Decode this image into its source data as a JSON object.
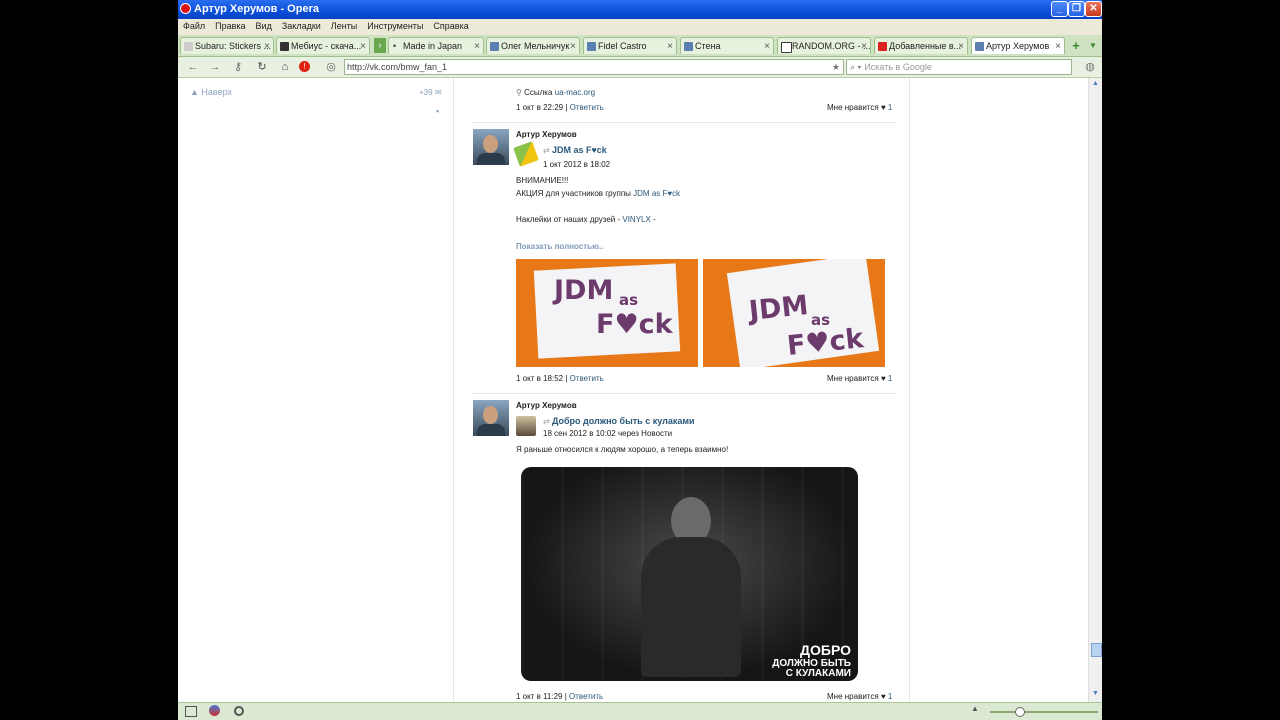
{
  "window": {
    "title": "Артур Херумов - Opera"
  },
  "menu": [
    "Файл",
    "Правка",
    "Вид",
    "Закладки",
    "Ленты",
    "Инструменты",
    "Справка"
  ],
  "tabs": [
    "Subaru: Stickers ...",
    "Мебиус - скача...",
    "Made in Japan",
    "Олег Мельничук",
    "Fidel Castro",
    "Стена",
    "RANDOM.ORG - ...",
    "Добавленные в...",
    "Артур Херумов"
  ],
  "address": "http://vk.com/bmw_fan_1",
  "search_placeholder": "Искать в Google",
  "sidebar": {
    "up_label": "Наверх",
    "count": "+39"
  },
  "top_post": {
    "link_label": "Ссылка",
    "link_url": "ua-mac.org",
    "time": "1 окт в 22:29",
    "reply": "Ответить",
    "like": "Мне нравится",
    "likes": "1"
  },
  "posts": [
    {
      "author": "Артур Херумов",
      "repost_from": "JDM as F♥ck",
      "repost_time": "1 окт 2012 в 18:02",
      "text1": "ВНИМАНИЕ!!!",
      "text2_prefix": "АКЦИЯ для участников группы ",
      "text2_link": "JDM as F♥ck",
      "text3_prefix": "Наклейки от наших друзей - ",
      "text3_link": "VINYLX",
      "text3_suffix": " -",
      "show_more": "Показать полностью..",
      "sticker_line1": "JDM",
      "sticker_as": "as",
      "sticker_line2": "F♥ck",
      "time": "1 окт в 18:52",
      "reply": "Ответить",
      "like": "Мне нравится",
      "likes": "1"
    },
    {
      "author": "Артур Херумов",
      "repost_from": "Добро должно быть с кулаками",
      "repost_time": "18 сен 2012 в 10:02 через Новости",
      "text1": "Я раньше относился к людям хорошо, а теперь взаимно!",
      "image_caption_1": "ДОБРО",
      "image_caption_2": "ДОЛЖНО БЫТЬ",
      "image_caption_3": "С КУЛАКАМИ",
      "time": "1 окт в 11:29",
      "reply": "Ответить",
      "like": "Мне нравится",
      "likes": "1"
    }
  ],
  "colors": {
    "link": "#2b587a",
    "titlebar": "#0a4fd8",
    "tabbar": "#cfe3c2",
    "sticker_bg": "#e87817"
  }
}
